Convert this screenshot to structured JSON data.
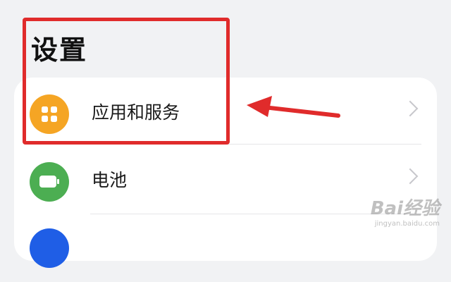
{
  "header": {
    "title": "设置"
  },
  "settings_list": {
    "items": [
      {
        "label": "应用和服务",
        "icon": "apps-grid-icon",
        "icon_color": "#f5a524"
      },
      {
        "label": "电池",
        "icon": "battery-icon",
        "icon_color": "#4cae52"
      },
      {
        "label": "",
        "icon": "blue-circle-icon",
        "icon_color": "#1f5ee6"
      }
    ]
  },
  "annotation": {
    "box_color": "#e02b2b",
    "arrow_color": "#e02b2b"
  },
  "watermark": {
    "title": "Bai经验",
    "subtitle": "jingyan.baidu.com"
  }
}
